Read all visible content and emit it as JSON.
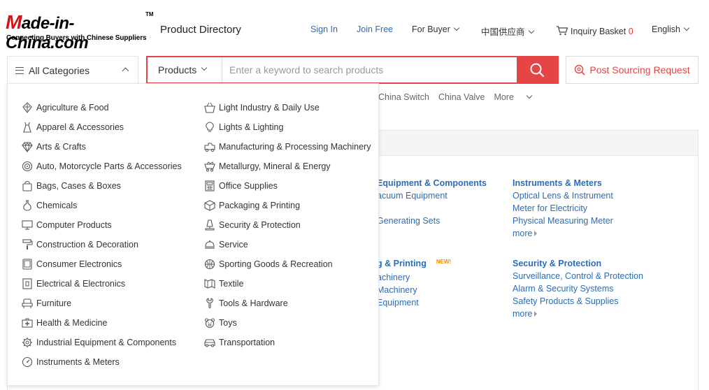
{
  "header": {
    "logo_text": "Made-in-China.com",
    "logo_tm": "TM",
    "logo_slogan": "Connecting Buyers with Chinese Suppliers",
    "section_title": "Product Directory",
    "sign_in": "Sign In",
    "join_free": "Join Free",
    "for_buyer": "For Buyer",
    "chinese_suppliers": "中国供应商",
    "inquiry_basket": "Inquiry Basket",
    "inquiry_count": "0",
    "language": "English"
  },
  "search": {
    "all_categories": "All Categories",
    "type_selected": "Products",
    "placeholder": "Enter a keyword to search products",
    "post_request": "Post Sourcing Request"
  },
  "hot_words": [
    "China Switch",
    "China Valve",
    "More"
  ],
  "directory": {
    "col_a": {
      "group1": {
        "heading": "Equipment & Components",
        "links": [
          "acuum Equipment",
          "",
          "Generating Sets"
        ]
      },
      "group2": {
        "heading": "g & Printing",
        "badge": "NEW!",
        "links": [
          "achinery",
          "Machinery",
          "Equipment"
        ]
      }
    },
    "col_b": {
      "group1": {
        "heading": "Instruments & Meters",
        "links": [
          "Optical Lens & Instrument",
          "Meter for Electricity",
          "Physical Measuring Meter"
        ],
        "more": "more"
      },
      "group2": {
        "heading": "Security & Protection",
        "links": [
          "Surveillance, Control & Protection",
          "Alarm & Security Systems",
          "Safety Products & Supplies"
        ],
        "more": "more"
      }
    }
  },
  "categories_left": [
    {
      "label": "Agriculture & Food",
      "icon": "agriculture-icon"
    },
    {
      "label": "Apparel & Accessories",
      "icon": "apparel-icon"
    },
    {
      "label": "Arts & Crafts",
      "icon": "diamond-icon"
    },
    {
      "label": "Auto, Motorcycle Parts & Accessories",
      "icon": "wheel-icon"
    },
    {
      "label": "Bags, Cases & Boxes",
      "icon": "bag-icon"
    },
    {
      "label": "Chemicals",
      "icon": "flask-icon"
    },
    {
      "label": "Computer Products",
      "icon": "monitor-icon"
    },
    {
      "label": "Construction & Decoration",
      "icon": "paint-roller-icon"
    },
    {
      "label": "Consumer Electronics",
      "icon": "tablet-icon"
    },
    {
      "label": "Electrical & Electronics",
      "icon": "socket-icon"
    },
    {
      "label": "Furniture",
      "icon": "sofa-icon"
    },
    {
      "label": "Health & Medicine",
      "icon": "medkit-icon"
    },
    {
      "label": "Industrial Equipment & Components",
      "icon": "gear-icon"
    },
    {
      "label": "Instruments & Meters",
      "icon": "gauge-icon"
    }
  ],
  "categories_right": [
    {
      "label": "Light Industry & Daily Use",
      "icon": "basket-icon"
    },
    {
      "label": "Lights & Lighting",
      "icon": "bulb-icon"
    },
    {
      "label": "Manufacturing & Processing Machinery",
      "icon": "machine-icon"
    },
    {
      "label": "Metallurgy, Mineral & Energy",
      "icon": "mine-cart-icon"
    },
    {
      "label": "Office Supplies",
      "icon": "calculator-icon"
    },
    {
      "label": "Packaging & Printing",
      "icon": "box-icon"
    },
    {
      "label": "Security & Protection",
      "icon": "lamp-icon"
    },
    {
      "label": "Service",
      "icon": "cloche-icon"
    },
    {
      "label": "Sporting Goods & Recreation",
      "icon": "ball-icon"
    },
    {
      "label": "Textile",
      "icon": "fabric-icon"
    },
    {
      "label": "Tools & Hardware",
      "icon": "wrench-icon"
    },
    {
      "label": "Toys",
      "icon": "bear-icon"
    },
    {
      "label": "Transportation",
      "icon": "car-icon"
    }
  ],
  "colors": {
    "brand_red": "#d1141b",
    "accent_red": "#e64545",
    "link_blue": "#2b6cb7",
    "badge_orange": "#ff8a00"
  }
}
